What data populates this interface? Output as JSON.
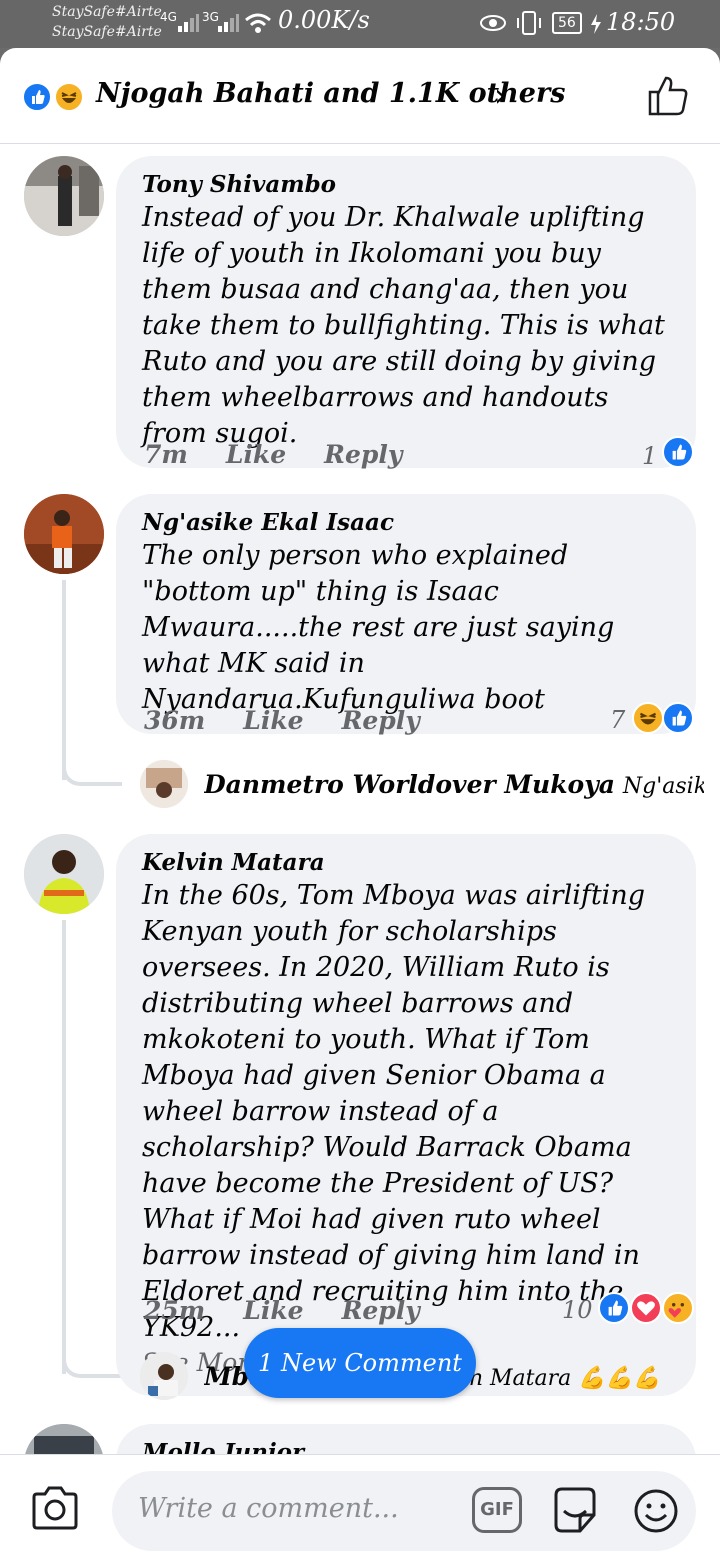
{
  "status_bar": {
    "carrier1": "StaySafe#Airte",
    "carrier2": "StaySafe#Airte",
    "signal1": "4G",
    "signal2": "3G",
    "speed": "0.00K/s",
    "battery": "56",
    "time": "18:50"
  },
  "reactions_bar": {
    "names": "Njogah Bahati and 1.1K others",
    "chevron": "›"
  },
  "comments": [
    {
      "author": "Tony Shivambo",
      "text": "Instead of you Dr. Khalwale uplifting life of youth in Ikolomani you buy them busaa and chang'aa, then you take them to bullfighting. This is what Ruto and you are still doing by giving them wheelbarrows and handouts from sugoi.",
      "time": "7m",
      "like_label": "Like",
      "reply_label": "Reply",
      "reaction_count": "1",
      "reactions": [
        "like-icon"
      ]
    },
    {
      "author": "Ng'asike Ekal Isaac",
      "text": "The only person who explained \"bottom up\" thing is Isaac Mwaura.....the rest are just saying what MK said in Nyandarua.Kufunguliwa boot",
      "time": "36m",
      "like_label": "Like",
      "reply_label": "Reply",
      "reaction_count": "7",
      "reactions": [
        "haha-icon",
        "like-icon"
      ],
      "reply": {
        "author": "Danmetro Worldover Mukoya",
        "preview": "Ng'asike Ekal Is..."
      }
    },
    {
      "author": "Kelvin Matara",
      "text": "In the 60s, Tom Mboya was airlifting Kenyan youth for scholarships oversees. In 2020, William Ruto is distributing wheel barrows and mkokoteni to youth. What if Tom Mboya had given Senior Obama a wheel barrow instead of a scholarship? Would Barrack Obama have become the President of US? What if Moi had given ruto wheel barrow instead of giving him land in Eldoret and recruiting him into the YK92...",
      "see_more": "See More",
      "time": "25m",
      "like_label": "Like",
      "reply_label": "Reply",
      "reaction_count": "10",
      "reactions": [
        "like-icon",
        "love-icon",
        "care-icon"
      ],
      "reply": {
        "author": "Mbarikiwa Soi",
        "preview": "Kelvin Matara 💪💪💪"
      }
    },
    {
      "author": "Mollo Junior"
    }
  ],
  "new_comment_pill": "1 New Comment",
  "composer": {
    "placeholder": "Write a comment...",
    "gif_label": "GIF"
  },
  "colors": {
    "accent": "#1877f2",
    "bubble": "#f0f2f5",
    "secondary_text": "#65676b"
  }
}
